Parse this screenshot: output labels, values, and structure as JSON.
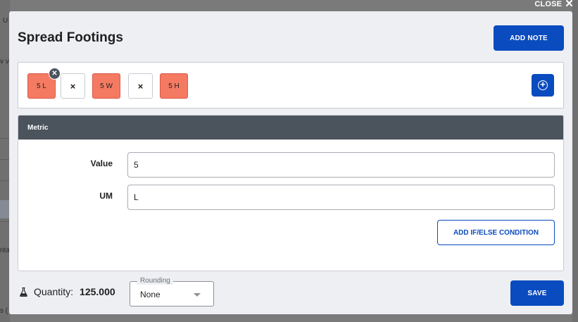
{
  "close_label": "CLOSE",
  "modal": {
    "title": "Spread Footings",
    "add_note_label": "ADD NOTE"
  },
  "formula": {
    "tokens": [
      {
        "label": "5 L",
        "kind": "value"
      },
      {
        "label": "×",
        "kind": "operator"
      },
      {
        "label": "5 W",
        "kind": "value"
      },
      {
        "label": "×",
        "kind": "operator"
      },
      {
        "label": "5 H",
        "kind": "value"
      }
    ]
  },
  "metric": {
    "header": "Metric",
    "value_label": "Value",
    "value": "5",
    "um_label": "UM",
    "um": "L",
    "add_condition_label": "ADD IF/ELSE CONDITION"
  },
  "footer": {
    "quantity_label": "Quantity:",
    "quantity_value": "125.000",
    "rounding_label": "Rounding",
    "rounding_value": "None",
    "save_label": "SAVE"
  },
  "background": {
    "fragments": [
      "U",
      "v vi",
      "nta",
      "s ("
    ]
  },
  "colors": {
    "accent": "#0a4bbf",
    "token_value": "#f47a62",
    "panel_header": "#4b535d"
  },
  "icons": [
    "close-icon",
    "remove-token-icon",
    "add-circle-icon",
    "flask-icon",
    "caret-down-icon"
  ]
}
